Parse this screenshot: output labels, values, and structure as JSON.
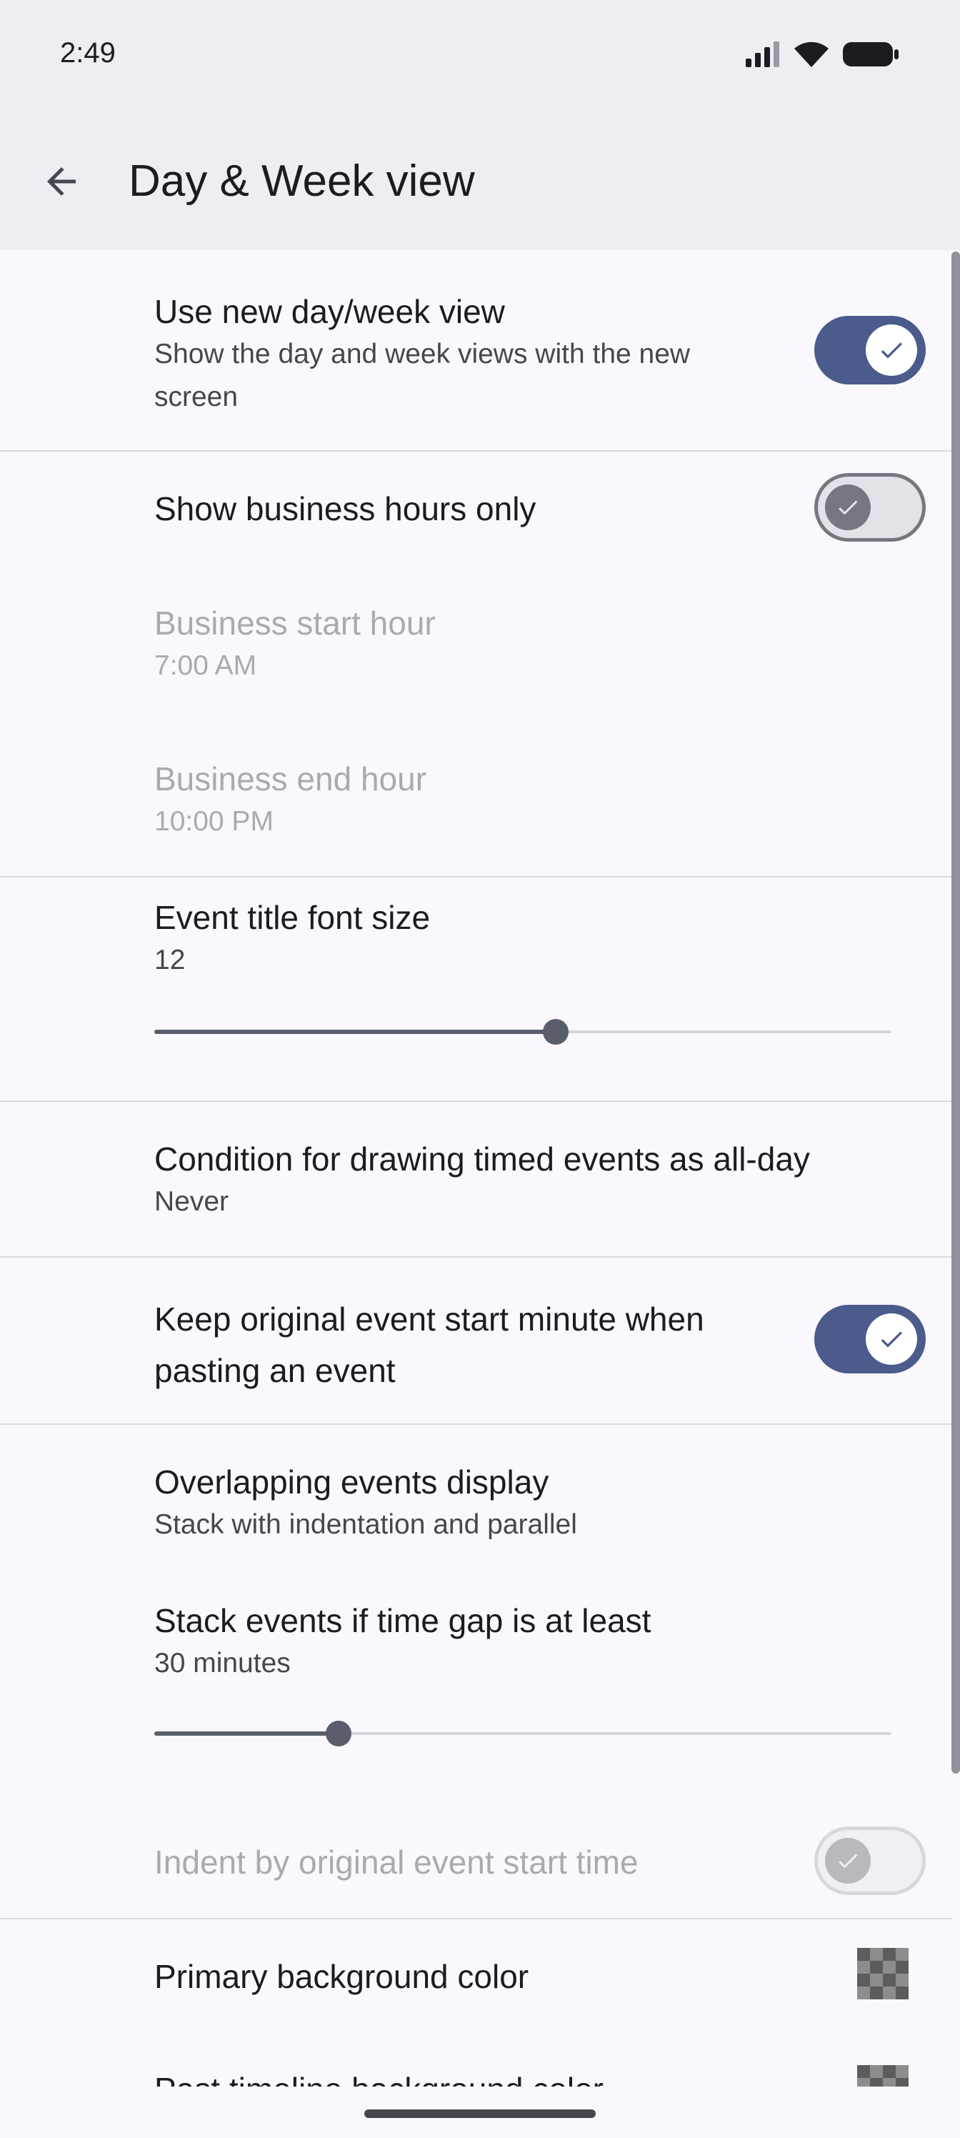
{
  "status": {
    "time": "2:49"
  },
  "appbar": {
    "title": "Day & Week view"
  },
  "settings": {
    "new_view": {
      "title": "Use new day/week view",
      "summary": "Show the day and week views with the new screen",
      "checked": true
    },
    "business_hours": {
      "title": "Show business hours only",
      "checked": false
    },
    "start_hour": {
      "title": "Business start hour",
      "value": "7:00 AM"
    },
    "end_hour": {
      "title": "Business end hour",
      "value": "10:00 PM"
    },
    "font_size": {
      "title": "Event title font size",
      "value": "12",
      "level": 0.545
    },
    "all_day": {
      "title": "Condition for drawing timed events as all-day",
      "value": "Never"
    },
    "keep_minute": {
      "title": "Keep original event start minute when pasting an event",
      "checked": true
    },
    "overlap": {
      "title": "Overlapping events display",
      "value": "Stack with indentation and parallel"
    },
    "stack_gap": {
      "title": "Stack events if time gap is at least",
      "value": "30 minutes",
      "level": 0.25
    },
    "indent": {
      "title": "Indent by original event start time",
      "checked": false
    },
    "primary_bg": {
      "title": "Primary background color"
    },
    "past_bg": {
      "title": "Past timeline background color"
    }
  },
  "colors": {
    "accent": "#4a5b8c",
    "surface": "#faf8fd",
    "header": "#eceef4"
  }
}
